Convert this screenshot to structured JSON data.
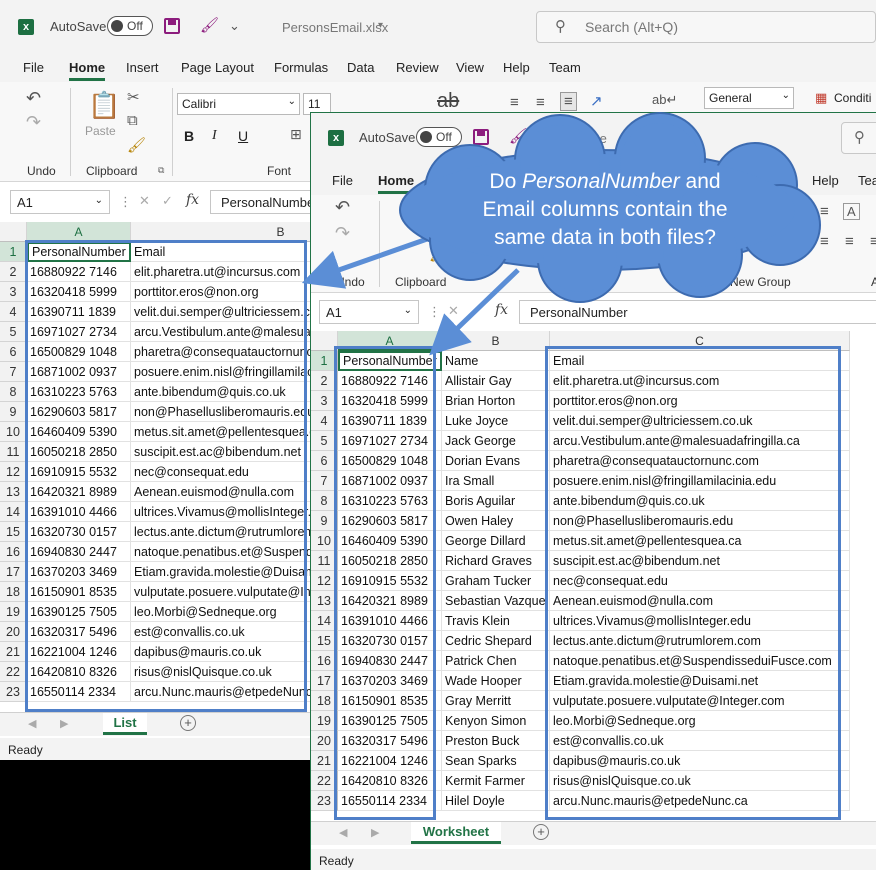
{
  "back_window": {
    "autosave_label": "AutoSave",
    "toggle_label": "Off",
    "filename": "PersonsEmail.xlsx",
    "filename_caret": "▾",
    "search_placeholder": "Search (Alt+Q)",
    "menu": [
      "File",
      "Home",
      "Insert",
      "Page Layout",
      "Formulas",
      "Data",
      "Review",
      "View",
      "Help",
      "Team"
    ],
    "ribbon": {
      "undo_label": "Undo",
      "clipboard_label": "Clipboard",
      "paste_label": "Paste",
      "font_label": "Font",
      "font_name": "Calibri",
      "font_size": "11",
      "number_format": "General",
      "conditional_label": "Conditi",
      "bold": "B",
      "italic": "I",
      "underline": "U"
    },
    "name_box": "A1",
    "fx": "fx",
    "formula_value": "PersonalNumber",
    "col_headers": [
      "A",
      "B"
    ],
    "row_numbers": [
      "1",
      "2",
      "3",
      "4",
      "5",
      "6",
      "7",
      "8",
      "9",
      "10",
      "11",
      "12",
      "13",
      "14",
      "15",
      "16",
      "17",
      "18",
      "19",
      "20",
      "21",
      "22",
      "23"
    ],
    "rows": [
      [
        "PersonalNumber",
        "Email"
      ],
      [
        "16880922 7146",
        "elit.pharetra.ut@incursus.com"
      ],
      [
        "16320418 5999",
        "porttitor.eros@non.org"
      ],
      [
        "16390711 1839",
        "velit.dui.semper@ultriciessem.co.uk"
      ],
      [
        "16971027 2734",
        "arcu.Vestibulum.ante@malesuadafringilla.ca"
      ],
      [
        "16500829 1048",
        "pharetra@consequatauctornunc.com"
      ],
      [
        "16871002 0937",
        "posuere.enim.nisl@fringillamilacinia.edu"
      ],
      [
        "16310223 5763",
        "ante.bibendum@quis.co.uk"
      ],
      [
        "16290603 5817",
        "non@Phasellusliberomauris.edu"
      ],
      [
        "16460409 5390",
        "metus.sit.amet@pellentesquea.ca"
      ],
      [
        "16050218 2850",
        "suscipit.est.ac@bibendum.net"
      ],
      [
        "16910915 5532",
        "nec@consequat.edu"
      ],
      [
        "16420321 8989",
        "Aenean.euismod@nulla.com"
      ],
      [
        "16391010 4466",
        "ultrices.Vivamus@mollisInteger.edu"
      ],
      [
        "16320730 0157",
        "lectus.ante.dictum@rutrumlorem.com"
      ],
      [
        "16940830 2447",
        "natoque.penatibus.et@SuspendisseduiFusce.com"
      ],
      [
        "16370203 3469",
        "Etiam.gravida.molestie@Duisami.net"
      ],
      [
        "16150901 8535",
        "vulputate.posuere.vulputate@Integer.com"
      ],
      [
        "16390125 7505",
        "leo.Morbi@Sedneque.org"
      ],
      [
        "16320317 5496",
        "est@convallis.co.uk"
      ],
      [
        "16221004 1246",
        "dapibus@mauris.co.uk"
      ],
      [
        "16420810 8326",
        "risus@nislQuisque.co.uk"
      ],
      [
        "16550114 2334",
        "arcu.Nunc.mauris@etpedeNunc.ca"
      ]
    ],
    "sheet_tab": "List",
    "add_sheet": "+",
    "status": "Ready"
  },
  "front_window": {
    "autosave_label": "AutoSave",
    "toggle_label": "Off",
    "filename": "Pe",
    "menu": [
      "File",
      "Home",
      "Help",
      "Tea"
    ],
    "menu_view_fragment": "ew",
    "ribbon": {
      "undo_label": "Undo",
      "clipboard_label": "Clipboard",
      "font_fragment": "ont",
      "new_group_label": "New Group",
      "last_fragment": "A"
    },
    "name_box": "A1",
    "fx": "fx",
    "formula_value": "PersonalNumber",
    "col_headers": [
      "A",
      "B",
      "C"
    ],
    "row_numbers": [
      "1",
      "2",
      "3",
      "4",
      "5",
      "6",
      "7",
      "8",
      "9",
      "10",
      "11",
      "12",
      "13",
      "14",
      "15",
      "16",
      "17",
      "18",
      "19",
      "20",
      "21",
      "22",
      "23"
    ],
    "rows": [
      [
        "PersonalNumber",
        "Name",
        "Email"
      ],
      [
        "16880922 7146",
        "Allistair Gay",
        "elit.pharetra.ut@incursus.com"
      ],
      [
        "16320418 5999",
        "Brian Horton",
        "porttitor.eros@non.org"
      ],
      [
        "16390711 1839",
        "Luke Joyce",
        "velit.dui.semper@ultriciessem.co.uk"
      ],
      [
        "16971027 2734",
        "Jack George",
        "arcu.Vestibulum.ante@malesuadafringilla.ca"
      ],
      [
        "16500829 1048",
        "Dorian Evans",
        "pharetra@consequatauctornunc.com"
      ],
      [
        "16871002 0937",
        "Ira Small",
        "posuere.enim.nisl@fringillamilacinia.edu"
      ],
      [
        "16310223 5763",
        "Boris Aguilar",
        "ante.bibendum@quis.co.uk"
      ],
      [
        "16290603 5817",
        "Owen Haley",
        "non@Phasellusliberomauris.edu"
      ],
      [
        "16460409 5390",
        "George Dillard",
        "metus.sit.amet@pellentesquea.ca"
      ],
      [
        "16050218 2850",
        "Richard Graves",
        "suscipit.est.ac@bibendum.net"
      ],
      [
        "16910915 5532",
        "Graham Tucker",
        "nec@consequat.edu"
      ],
      [
        "16420321 8989",
        "Sebastian Vazque",
        "Aenean.euismod@nulla.com"
      ],
      [
        "16391010 4466",
        "Travis Klein",
        "ultrices.Vivamus@mollisInteger.edu"
      ],
      [
        "16320730 0157",
        "Cedric Shepard",
        "lectus.ante.dictum@rutrumlorem.com"
      ],
      [
        "16940830 2447",
        "Patrick Chen",
        "natoque.penatibus.et@SuspendisseduiFusce.com"
      ],
      [
        "16370203 3469",
        "Wade Hooper",
        "Etiam.gravida.molestie@Duisami.net"
      ],
      [
        "16150901 8535",
        "Gray Merritt",
        "vulputate.posuere.vulputate@Integer.com"
      ],
      [
        "16390125 7505",
        "Kenyon Simon",
        "leo.Morbi@Sedneque.org"
      ],
      [
        "16320317 5496",
        "Preston Buck",
        "est@convallis.co.uk"
      ],
      [
        "16221004 1246",
        "Sean Sparks",
        "dapibus@mauris.co.uk"
      ],
      [
        "16420810 8326",
        "Kermit Farmer",
        "risus@nislQuisque.co.uk"
      ],
      [
        "16550114 2334",
        "Hilel Doyle",
        "arcu.Nunc.mauris@etpedeNunc.ca"
      ]
    ],
    "sheet_tab": "Worksheet",
    "add_sheet": "+",
    "status": "Ready"
  },
  "callout": {
    "line1_a": "Do ",
    "line1_em": "PersonalNumber",
    "line1_b": " and",
    "line2_em": "Email",
    "line2_b": " columns contain the",
    "line3": "same data in both files?"
  },
  "colors": {
    "excel_green": "#217346",
    "highlight_blue": "#4f7fc8",
    "callout_fill": "#5b8ed6"
  }
}
